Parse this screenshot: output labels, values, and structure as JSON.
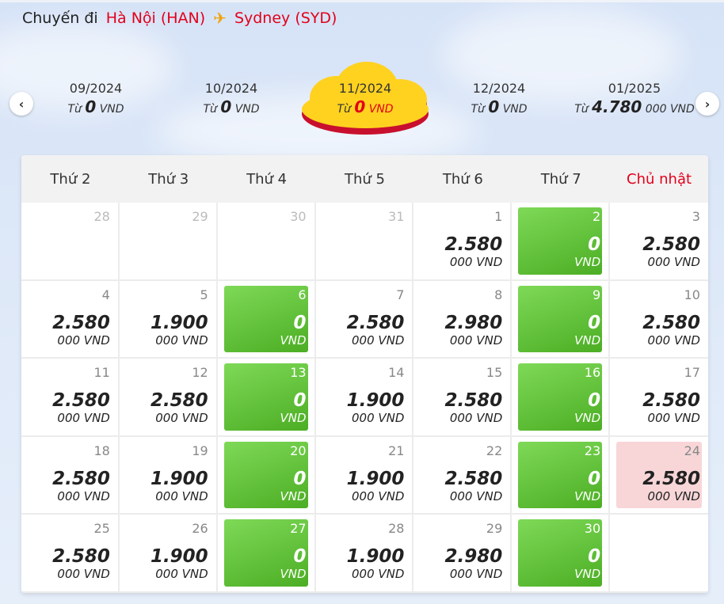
{
  "header": {
    "label": "Chuyến đi",
    "origin": "Hà Nội (HAN)",
    "destination": "Sydney (SYD)"
  },
  "months": [
    {
      "month": "09/2024",
      "prefix": "Từ",
      "amount": "0",
      "unit": "VND",
      "selected": false
    },
    {
      "month": "10/2024",
      "prefix": "Từ",
      "amount": "0",
      "unit": "VND",
      "selected": false
    },
    {
      "month": "11/2024",
      "prefix": "Từ",
      "amount": "0",
      "unit": "VND",
      "selected": true
    },
    {
      "month": "12/2024",
      "prefix": "Từ",
      "amount": "0",
      "unit": "VND",
      "selected": false
    },
    {
      "month": "01/2025",
      "prefix": "Từ",
      "amount": "4.780",
      "unit": "000 VND",
      "selected": false
    }
  ],
  "weekdays": [
    "Thứ 2",
    "Thứ 3",
    "Thứ 4",
    "Thứ 5",
    "Thứ 6",
    "Thứ 7",
    "Chủ nhật"
  ],
  "days": [
    {
      "day": "28",
      "price": "",
      "unit": "",
      "type": "other"
    },
    {
      "day": "29",
      "price": "",
      "unit": "",
      "type": "other"
    },
    {
      "day": "30",
      "price": "",
      "unit": "",
      "type": "other"
    },
    {
      "day": "31",
      "price": "",
      "unit": "",
      "type": "other"
    },
    {
      "day": "1",
      "price": "2.580",
      "unit": "000 VND",
      "type": "normal"
    },
    {
      "day": "2",
      "price": "0",
      "unit": "VND",
      "type": "green"
    },
    {
      "day": "3",
      "price": "2.580",
      "unit": "000 VND",
      "type": "normal"
    },
    {
      "day": "4",
      "price": "2.580",
      "unit": "000 VND",
      "type": "normal"
    },
    {
      "day": "5",
      "price": "1.900",
      "unit": "000 VND",
      "type": "normal"
    },
    {
      "day": "6",
      "price": "0",
      "unit": "VND",
      "type": "green"
    },
    {
      "day": "7",
      "price": "2.580",
      "unit": "000 VND",
      "type": "normal"
    },
    {
      "day": "8",
      "price": "2.980",
      "unit": "000 VND",
      "type": "normal"
    },
    {
      "day": "9",
      "price": "0",
      "unit": "VND",
      "type": "green"
    },
    {
      "day": "10",
      "price": "2.580",
      "unit": "000 VND",
      "type": "normal"
    },
    {
      "day": "11",
      "price": "2.580",
      "unit": "000 VND",
      "type": "normal"
    },
    {
      "day": "12",
      "price": "2.580",
      "unit": "000 VND",
      "type": "normal"
    },
    {
      "day": "13",
      "price": "0",
      "unit": "VND",
      "type": "green"
    },
    {
      "day": "14",
      "price": "1.900",
      "unit": "000 VND",
      "type": "normal"
    },
    {
      "day": "15",
      "price": "2.580",
      "unit": "000 VND",
      "type": "normal"
    },
    {
      "day": "16",
      "price": "0",
      "unit": "VND",
      "type": "green"
    },
    {
      "day": "17",
      "price": "2.580",
      "unit": "000 VND",
      "type": "normal"
    },
    {
      "day": "18",
      "price": "2.580",
      "unit": "000 VND",
      "type": "normal"
    },
    {
      "day": "19",
      "price": "1.900",
      "unit": "000 VND",
      "type": "normal"
    },
    {
      "day": "20",
      "price": "0",
      "unit": "VND",
      "type": "green"
    },
    {
      "day": "21",
      "price": "1.900",
      "unit": "000 VND",
      "type": "normal"
    },
    {
      "day": "22",
      "price": "2.580",
      "unit": "000 VND",
      "type": "normal"
    },
    {
      "day": "23",
      "price": "0",
      "unit": "VND",
      "type": "green"
    },
    {
      "day": "24",
      "price": "2.580",
      "unit": "000 VND",
      "type": "pink"
    },
    {
      "day": "25",
      "price": "2.580",
      "unit": "000 VND",
      "type": "normal"
    },
    {
      "day": "26",
      "price": "1.900",
      "unit": "000 VND",
      "type": "normal"
    },
    {
      "day": "27",
      "price": "0",
      "unit": "VND",
      "type": "green"
    },
    {
      "day": "28",
      "price": "1.900",
      "unit": "000 VND",
      "type": "normal"
    },
    {
      "day": "29",
      "price": "2.980",
      "unit": "000 VND",
      "type": "normal"
    },
    {
      "day": "30",
      "price": "0",
      "unit": "VND",
      "type": "green"
    },
    {
      "day": "",
      "price": "",
      "unit": "",
      "type": "empty"
    }
  ],
  "colors": {
    "brand_red": "#e2001a",
    "cheap_green": "#5cbd2f",
    "selected_pink": "#f8d6d8",
    "cloud_yellow": "#ffd21f"
  },
  "icons": {
    "prev": "chevron-left-icon",
    "next": "chevron-right-icon",
    "plane": "airplane-icon"
  }
}
